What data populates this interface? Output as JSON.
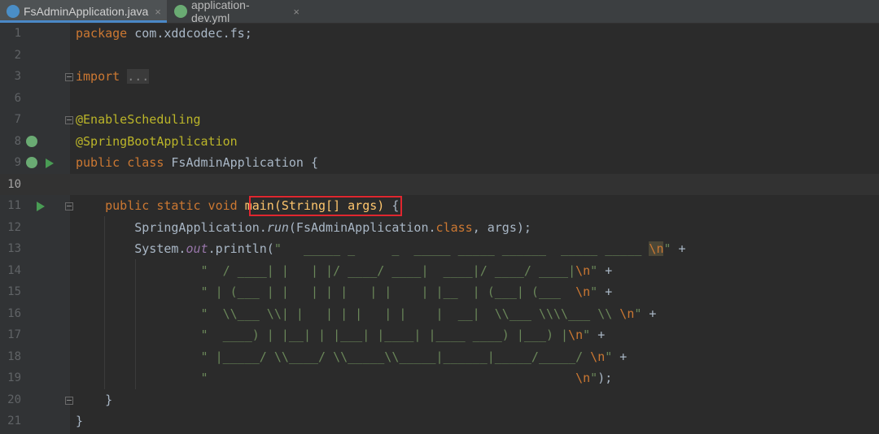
{
  "tabs": [
    {
      "label": "FsAdminApplication.java",
      "active": true,
      "icon": "java-class-icon"
    },
    {
      "label": "application-dev.yml",
      "active": false,
      "icon": "yml-file-icon"
    }
  ],
  "tab_close_glyph": "×",
  "line_numbers": [
    "1",
    "2",
    "3",
    "6",
    "7",
    "8",
    "9",
    "10",
    "11",
    "12",
    "13",
    "14",
    "15",
    "16",
    "17",
    "18",
    "19",
    "20",
    "21"
  ],
  "code": {
    "l1": {
      "kw": "package",
      "rest": " com.xddcodec.fs;"
    },
    "l3": {
      "kw": "import",
      "folded": "..."
    },
    "l7": "@EnableScheduling",
    "l8": "@SpringBootApplication",
    "l9": {
      "kw1": "public",
      "kw2": "class",
      "rest": " FsAdminApplication {"
    },
    "l11": {
      "kw": "public static void",
      "method": "main(String[] args)",
      "rest": " {"
    },
    "l12": {
      "a": "SpringApplication.",
      "run": "run",
      "b": "(FsAdminApplication.",
      "cls": "class",
      "c": ", args);"
    },
    "l13": {
      "a": "System.",
      "out": "out",
      "b": ".println(",
      "str": "\"   _____ _     _  _____ _____ ______  _____ _____ "
    },
    "l14": "\"  / ____| |   | |/ ____/ ____|  ____|/ ____/ ____|",
    "l15": "\" | (___ | |   | | |   | |    | |__  | (___| (___  ",
    "l16": "\"  \\\\___ \\\\| |   | | |   | |    |  __|  \\\\___ \\\\\\\\___ \\\\ ",
    "l17": "\"  ____) | |__| | |___| |____| |____ ____) |___) |",
    "l18": "\" |_____/ \\\\____/ \\\\_____\\\\_____|______|_____/_____/ ",
    "l19": "\"                                                  ",
    "esc_n": "\\n",
    "str_end": "\"",
    "plus": " +",
    "close19": ");",
    "l20": "}",
    "l21": "}"
  },
  "colors": {
    "highlight_box": "#e0262f",
    "run_icon": "#499c54",
    "spring_icon": "#6aab73"
  }
}
